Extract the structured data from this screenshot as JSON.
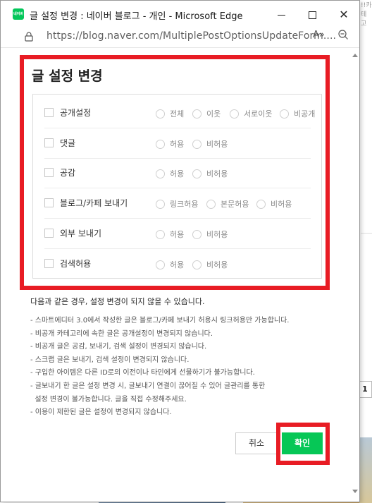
{
  "window": {
    "app_icon_label": "네이버",
    "title": "글 설정 변경 : 네이버 블로그 - 개인 - Microsoft Edge",
    "url": "https://blog.naver.com/MultiplePostOptionsUpdateForm....",
    "read_aloud_label": "A»"
  },
  "background": {
    "right_top_text": "!!카테고",
    "right_box_text": "1"
  },
  "dialog": {
    "title": "글 설정 변경",
    "options": [
      {
        "label": "공개설정",
        "choices": [
          "전체",
          "이웃",
          "서로이웃",
          "비공개"
        ]
      },
      {
        "label": "댓글",
        "choices": [
          "허용",
          "비허용"
        ]
      },
      {
        "label": "공감",
        "choices": [
          "허용",
          "비허용"
        ]
      },
      {
        "label": "블로그/카페 보내기",
        "choices": [
          "링크허용",
          "본문허용",
          "비허용"
        ]
      },
      {
        "label": "외부 보내기",
        "choices": [
          "허용",
          "비허용"
        ]
      },
      {
        "label": "검색허용",
        "choices": [
          "허용",
          "비허용"
        ]
      }
    ],
    "notice_title": "다음과 같은 경우, 설정 변경이 되지 않을 수 있습니다.",
    "notices": [
      "- 스마트에디터 3.0에서 작성한 글은 블로그/카페 보내기 허용시 링크허용만 가능합니다.",
      "- 비공개 카테고리에 속한 글은 공개설정이 변경되지 않습니다.",
      "- 비공개 글은 공감, 보내기, 검색 설정이 변경되지 않습니다.",
      "- 스크랩 글은 보내기, 검색 설정이 변경되지 않습니다.",
      "- 구입한 아이템은 다른 ID로의 이전이나 타인에게 선물하기가 불가능합니다.",
      "- 글보내기 한 글은 설정 변경 시, 글보내기 연결이 끊어질 수 있어 글관리를 통한",
      "  설정 변경이 불가능합니다. 글을 직접 수정해주세요.",
      "- 이용이 제한된 글은 설정이 변경되지 않습니다."
    ],
    "cancel_label": "취소",
    "confirm_label": "확인"
  },
  "colors": {
    "highlight": "#e81c24",
    "confirm": "#06c756",
    "naver_green": "#03c75a"
  }
}
